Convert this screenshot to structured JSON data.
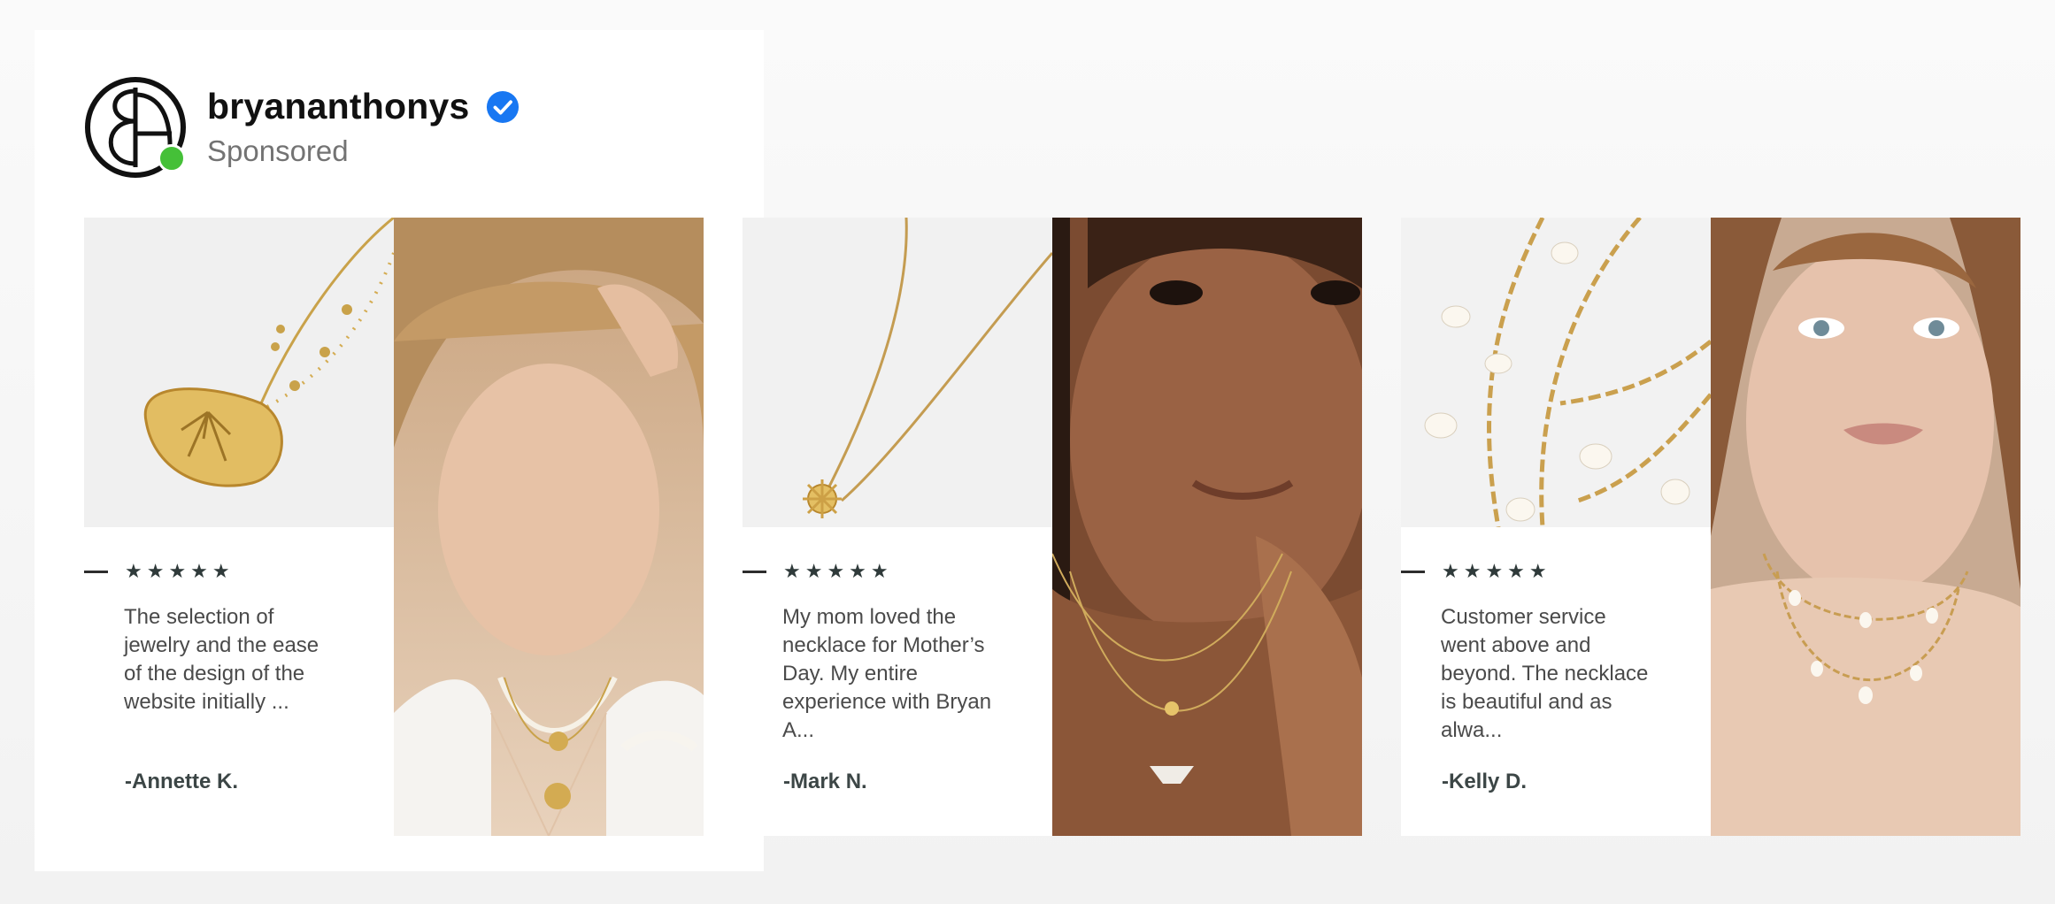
{
  "header": {
    "username": "bryananthonys",
    "sponsored_label": "Sponsored",
    "verified_icon": "verified-badge-icon",
    "avatar_icon": "brand-logo-icon",
    "status_color": "#45c038",
    "verified_color": "#1877f2"
  },
  "slides": [
    {
      "rating_icon": "five-star-icon",
      "stars": "★★★★★",
      "review": "The selection of jewelry and the ease of the design of the website initially ...",
      "reviewer": "-Annette K.",
      "product_icon": "sand-dollar-necklace-icon",
      "model_icon": "model-photo-icon"
    },
    {
      "rating_icon": "five-star-icon",
      "stars": "★★★★★",
      "review": "My mom loved the necklace for Mother’s Day. My entire experience with Bryan A...",
      "reviewer": "-Mark N.",
      "product_icon": "sun-pendant-necklace-icon",
      "model_icon": "model-photo-icon"
    },
    {
      "rating_icon": "five-star-icon",
      "stars": "★★★★★",
      "review": "Customer service went above and beyond. The necklace is beautiful and as alwa...",
      "reviewer": "-Kelly D.",
      "product_icon": "pearl-chain-necklace-icon",
      "model_icon": "model-photo-icon"
    }
  ]
}
